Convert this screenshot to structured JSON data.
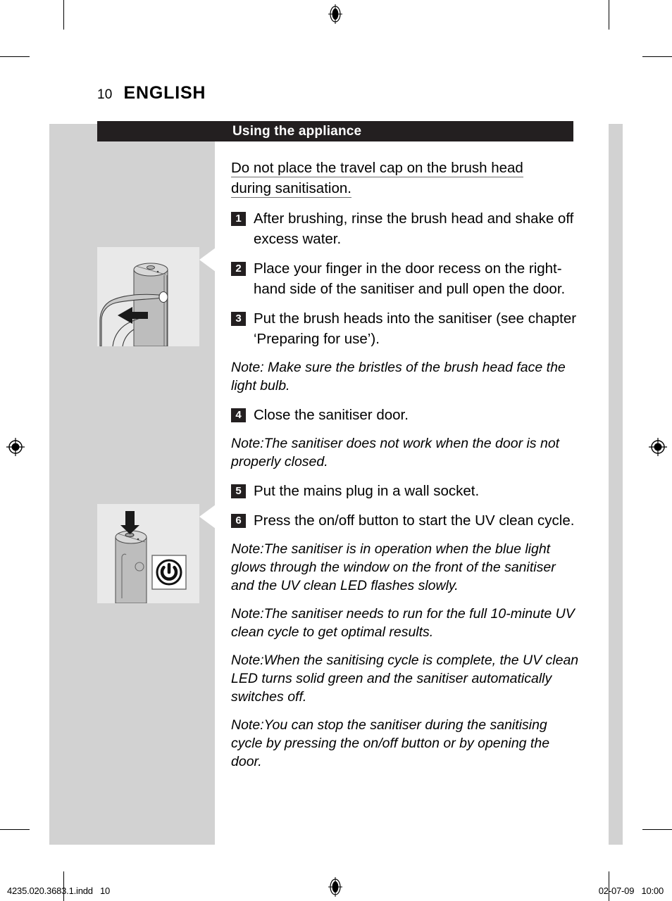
{
  "page": {
    "number": "10",
    "language": "ENGLISH"
  },
  "section": {
    "title": "Using the appliance"
  },
  "lead": {
    "line1": "Do not place the travel cap on the brush head",
    "line2": "during sanitisation."
  },
  "steps": [
    {
      "num": "1",
      "text": "After brushing, rinse the brush head and shake off excess water."
    },
    {
      "num": "2",
      "text": "Place your finger in the door recess on the right-hand side of the sanitiser and pull open the door."
    },
    {
      "num": "3",
      "text": "Put the brush heads into the sanitiser (see chapter ‘Preparing for use’)."
    },
    {
      "num": "4",
      "text": "Close the sanitiser door."
    },
    {
      "num": "5",
      "text": "Put the mains plug in a wall socket."
    },
    {
      "num": "6",
      "text": "Press the on/off button to start the UV clean cycle."
    }
  ],
  "notes": {
    "note1": "Note: Make sure the bristles of the brush head face the light bulb.",
    "note2": "Note:The sanitiser does not work when the door is not properly closed.",
    "note3": "Note:The sanitiser is in operation when the blue light glows through the window on the front of the sanitiser and the UV clean LED flashes slowly.",
    "note4": "Note:The sanitiser needs to run for the full 10-minute UV clean cycle to get optimal results.",
    "note5": "Note:When the sanitising cycle is complete, the UV clean LED turns solid green and the sanitiser automatically switches off.",
    "note6": "Note:You can stop the sanitiser during the sanitising cycle by pressing the on/off button or by opening the door."
  },
  "illustrations": {
    "illo1_name": "hand-opening-sanitiser-door",
    "illo2_name": "pressing-onoff-button-power-symbol"
  },
  "footer": {
    "filename": "4235.020.3683.1.indd   10",
    "timestamp": "02-07-09   10:00"
  },
  "colors": {
    "banner": "#231f20",
    "panel_grey": "#d2d2d2",
    "illustration_bg": "#e9e9e9",
    "underline": "#6f6f6f"
  }
}
